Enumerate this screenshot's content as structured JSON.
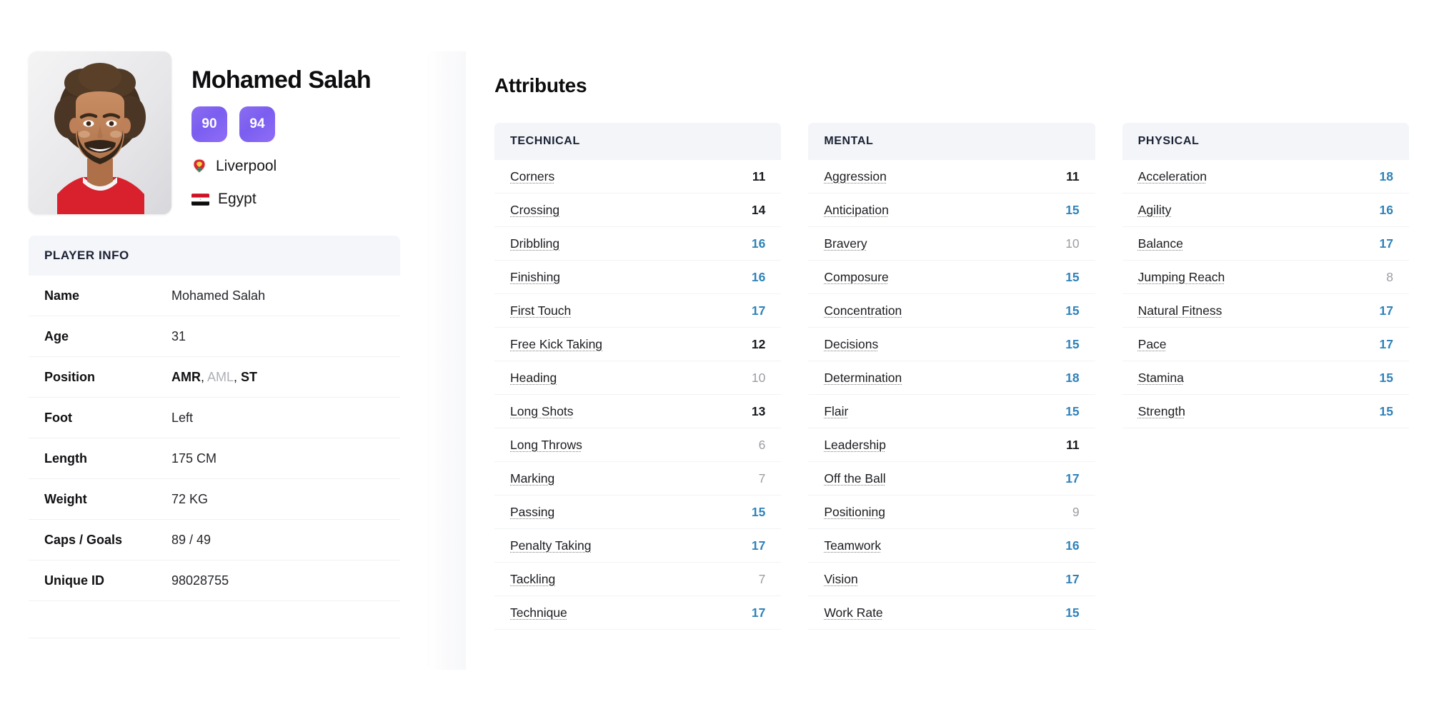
{
  "player": {
    "name": "Mohamed Salah",
    "badges": [
      "90",
      "94"
    ],
    "club": {
      "label": "Liverpool",
      "icon": "liverpool-crest-icon"
    },
    "nation": {
      "label": "Egypt",
      "icon": "egypt-flag-icon"
    },
    "avatar_alt": "Mohamed Salah portrait"
  },
  "player_info": {
    "header": "PLAYER INFO",
    "rows": [
      {
        "key": "Name",
        "value": "Mohamed Salah"
      },
      {
        "key": "Age",
        "value": "31"
      },
      {
        "key": "Position",
        "value": "AMR, AML, ST",
        "position_parts": [
          {
            "text": "AMR",
            "active": true
          },
          {
            "text": "AML",
            "active": false
          },
          {
            "text": "ST",
            "active": true
          }
        ]
      },
      {
        "key": "Foot",
        "value": "Left"
      },
      {
        "key": "Length",
        "value": "175 CM"
      },
      {
        "key": "Weight",
        "value": "72 KG"
      },
      {
        "key": "Caps / Goals",
        "value": "89 / 49"
      },
      {
        "key": "Unique ID",
        "value": "98028755"
      }
    ]
  },
  "attributes": {
    "title": "Attributes",
    "columns": [
      {
        "header": "TECHNICAL",
        "rows": [
          {
            "label": "Corners",
            "value": "11",
            "tier": "mid"
          },
          {
            "label": "Crossing",
            "value": "14",
            "tier": "mid"
          },
          {
            "label": "Dribbling",
            "value": "16",
            "tier": "high"
          },
          {
            "label": "Finishing",
            "value": "16",
            "tier": "high"
          },
          {
            "label": "First Touch",
            "value": "17",
            "tier": "high"
          },
          {
            "label": "Free Kick Taking",
            "value": "12",
            "tier": "mid"
          },
          {
            "label": "Heading",
            "value": "10",
            "tier": "low"
          },
          {
            "label": "Long Shots",
            "value": "13",
            "tier": "mid"
          },
          {
            "label": "Long Throws",
            "value": "6",
            "tier": "low"
          },
          {
            "label": "Marking",
            "value": "7",
            "tier": "low"
          },
          {
            "label": "Passing",
            "value": "15",
            "tier": "high"
          },
          {
            "label": "Penalty Taking",
            "value": "17",
            "tier": "high"
          },
          {
            "label": "Tackling",
            "value": "7",
            "tier": "low"
          },
          {
            "label": "Technique",
            "value": "17",
            "tier": "high"
          }
        ]
      },
      {
        "header": "MENTAL",
        "rows": [
          {
            "label": "Aggression",
            "value": "11",
            "tier": "mid"
          },
          {
            "label": "Anticipation",
            "value": "15",
            "tier": "high"
          },
          {
            "label": "Bravery",
            "value": "10",
            "tier": "low"
          },
          {
            "label": "Composure",
            "value": "15",
            "tier": "high"
          },
          {
            "label": "Concentration",
            "value": "15",
            "tier": "high"
          },
          {
            "label": "Decisions",
            "value": "15",
            "tier": "high"
          },
          {
            "label": "Determination",
            "value": "18",
            "tier": "high"
          },
          {
            "label": "Flair",
            "value": "15",
            "tier": "high"
          },
          {
            "label": "Leadership",
            "value": "11",
            "tier": "mid"
          },
          {
            "label": "Off the Ball",
            "value": "17",
            "tier": "high"
          },
          {
            "label": "Positioning",
            "value": "9",
            "tier": "low"
          },
          {
            "label": "Teamwork",
            "value": "16",
            "tier": "high"
          },
          {
            "label": "Vision",
            "value": "17",
            "tier": "high"
          },
          {
            "label": "Work Rate",
            "value": "15",
            "tier": "high"
          }
        ]
      },
      {
        "header": "PHYSICAL",
        "rows": [
          {
            "label": "Acceleration",
            "value": "18",
            "tier": "high"
          },
          {
            "label": "Agility",
            "value": "16",
            "tier": "high"
          },
          {
            "label": "Balance",
            "value": "17",
            "tier": "high"
          },
          {
            "label": "Jumping Reach",
            "value": "8",
            "tier": "low"
          },
          {
            "label": "Natural Fitness",
            "value": "17",
            "tier": "high"
          },
          {
            "label": "Pace",
            "value": "17",
            "tier": "high"
          },
          {
            "label": "Stamina",
            "value": "15",
            "tier": "high"
          },
          {
            "label": "Strength",
            "value": "15",
            "tier": "high"
          }
        ]
      }
    ]
  },
  "colors": {
    "badge_purple": "#7b5ef0",
    "value_high_blue": "#2f82b9",
    "value_mid_dark": "#16181d",
    "value_low_gray": "#9b9da3",
    "header_bg": "#f4f5f9",
    "header_text": "#1a2234"
  }
}
